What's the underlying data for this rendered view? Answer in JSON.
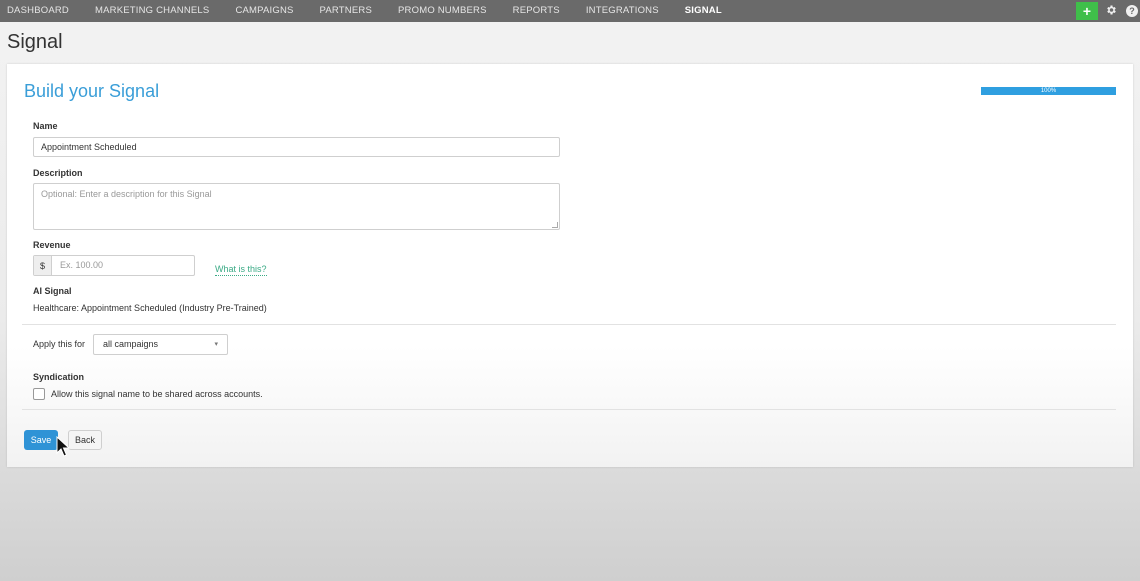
{
  "nav": {
    "items": [
      {
        "label": "DASHBOARD"
      },
      {
        "label": "MARKETING CHANNELS"
      },
      {
        "label": "CAMPAIGNS"
      },
      {
        "label": "PARTNERS"
      },
      {
        "label": "PROMO NUMBERS"
      },
      {
        "label": "REPORTS"
      },
      {
        "label": "INTEGRATIONS"
      },
      {
        "label": "SIGNAL",
        "active": true
      }
    ],
    "plus_label": "+",
    "icons": {
      "add": "plus-icon",
      "settings": "gear-icon",
      "help": "help-icon"
    },
    "help_glyph": "?"
  },
  "page": {
    "title": "Signal"
  },
  "form": {
    "title": "Build your Signal",
    "progress": {
      "value": 100,
      "label": "100%"
    },
    "name": {
      "label": "Name",
      "value": "Appointment Scheduled"
    },
    "description": {
      "label": "Description",
      "placeholder": "Optional: Enter a description for this Signal"
    },
    "revenue": {
      "label": "Revenue",
      "currency": "$",
      "placeholder": "Ex. 100.00",
      "help_link": "What is this?"
    },
    "ai_signal": {
      "label": "AI Signal",
      "value": "Healthcare: Appointment Scheduled (Industry Pre-Trained)"
    },
    "apply": {
      "label": "Apply this for",
      "selected": "all campaigns"
    },
    "syndication": {
      "label": "Syndication",
      "checkbox_label": "Allow this signal name to be shared across accounts.",
      "checked": false
    },
    "buttons": {
      "save": "Save",
      "back": "Back"
    }
  },
  "colors": {
    "nav_bg": "#6a6a6a",
    "accent": "#3a9ed8",
    "progress": "#2f9fe0",
    "primary_button": "#2f93d6",
    "add_button": "#3fbf4a",
    "link": "#3aaa85"
  }
}
